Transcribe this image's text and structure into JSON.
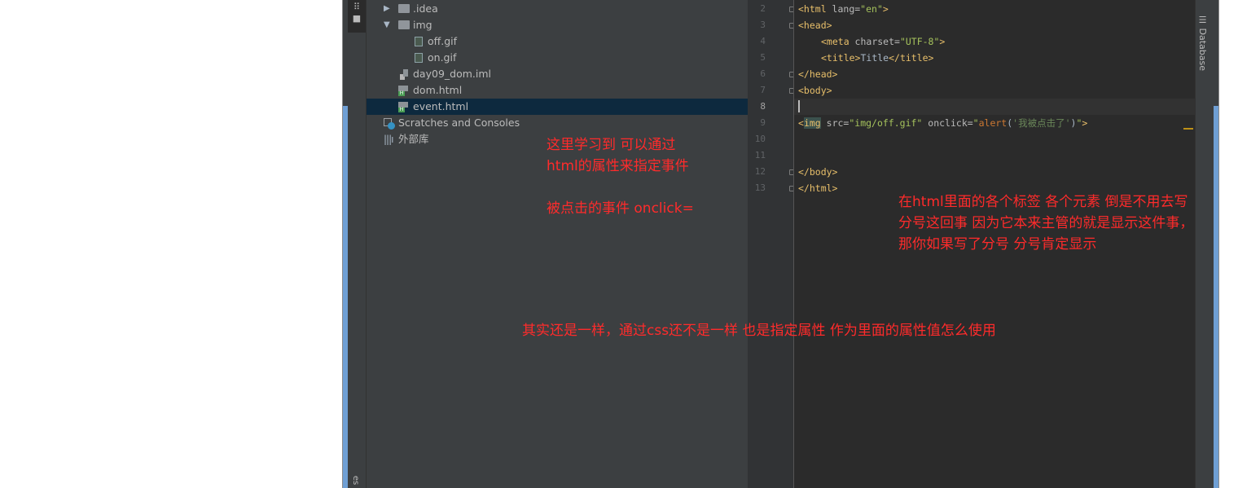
{
  "project_tree": {
    "items": [
      {
        "label": ".idea",
        "type": "folder",
        "state": "collapsed"
      },
      {
        "label": "img",
        "type": "folder",
        "state": "expanded"
      },
      {
        "label": "off.gif",
        "type": "file"
      },
      {
        "label": "on.gif",
        "type": "file"
      },
      {
        "label": "day09_dom.iml",
        "type": "iml"
      },
      {
        "label": "dom.html",
        "type": "html"
      },
      {
        "label": "event.html",
        "type": "html",
        "selected": true
      },
      {
        "label": "Scratches and Consoles",
        "type": "scratch"
      },
      {
        "label": "外部库",
        "type": "library"
      }
    ]
  },
  "editor": {
    "line_numbers": [
      "2",
      "3",
      "4",
      "5",
      "6",
      "7",
      "8",
      "9",
      "10",
      "11",
      "12",
      "13"
    ],
    "current_line": "8"
  },
  "right_panel": {
    "database_label": "Database"
  },
  "left_panel": {
    "bottom_label": "es"
  },
  "annotations": {
    "note1_line1": "这里学习到  可以通过",
    "note1_line2": "html的属性来指定事件",
    "note1_line3": "被点击的事件  onclick=",
    "note2_line1": "在html里面的各个标签 各个元素 倒是不用去写",
    "note2_line2": "分号这回事 因为它本来主管的就是显示这件事，",
    "note2_line3": "那你如果写了分号 分号肯定显示",
    "note3": "其实还是一样，通过css还不是一样 也是指定属性 作为里面的属性值怎么使用"
  },
  "colors": {
    "annotation": "#ff2b2b",
    "selection": "#0d293e",
    "editor_bg": "#2b2b2b",
    "panel_bg": "#3c3f41"
  }
}
